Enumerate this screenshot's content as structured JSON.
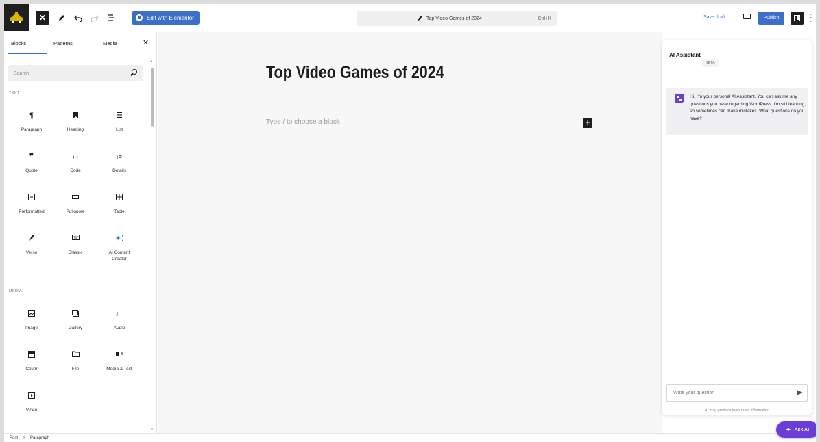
{
  "topbar": {
    "close_icon_label": "✕",
    "elementor_label": "Edit with Elementor",
    "command_title": "Top Video Games of 2024",
    "command_shortcut": "Ctrl+K",
    "save_draft": "Save draft",
    "publish": "Publish"
  },
  "inserter": {
    "tabs": [
      "Blocks",
      "Patterns",
      "Media"
    ],
    "search_placeholder": "Search",
    "category_text": "TEXT",
    "category_media": "MEDIA",
    "text_blocks": [
      {
        "label": "Paragraph",
        "icon": "paragraph-icon"
      },
      {
        "label": "Heading",
        "icon": "heading-icon"
      },
      {
        "label": "List",
        "icon": "list-icon"
      },
      {
        "label": "Quote",
        "icon": "quote-icon"
      },
      {
        "label": "Code",
        "icon": "code-icon"
      },
      {
        "label": "Details",
        "icon": "details-icon"
      },
      {
        "label": "Preformatted",
        "icon": "preformatted-icon"
      },
      {
        "label": "Pullquote",
        "icon": "pullquote-icon"
      },
      {
        "label": "Table",
        "icon": "table-icon"
      },
      {
        "label": "Verse",
        "icon": "verse-icon"
      },
      {
        "label": "Classic",
        "icon": "classic-icon"
      },
      {
        "label": "AI Content Creator",
        "icon": "ai-sparkle-icon"
      }
    ],
    "media_blocks": [
      {
        "label": "Image",
        "icon": "image-icon"
      },
      {
        "label": "Gallery",
        "icon": "gallery-icon"
      },
      {
        "label": "Audio",
        "icon": "audio-icon"
      },
      {
        "label": "Cover",
        "icon": "cover-icon"
      },
      {
        "label": "File",
        "icon": "file-icon"
      },
      {
        "label": "Media & Text",
        "icon": "media-text-icon"
      },
      {
        "label": "Video",
        "icon": "video-icon"
      }
    ]
  },
  "canvas": {
    "title": "Top Video Games of 2024",
    "placeholder": "Type / to choose a block"
  },
  "ai": {
    "title": "AI Assistant",
    "badge": "BETA",
    "message": "Hi, I'm your personal AI Assistant. You can ask me any questions you have regarding WordPress. I'm still learning, so sometimes can make mistakes. What questions do you have?",
    "input_placeholder": "Write your question",
    "disclaimer": "AI may produce inaccurate information",
    "ask_button": "Ask AI"
  },
  "footer": {
    "breadcrumb": [
      "Post",
      "Paragraph"
    ],
    "separator": ">"
  },
  "colors": {
    "accent_blue": "#3b6fc9",
    "ai_purple": "#6a3dd6",
    "dark": "#1e1e1e"
  }
}
